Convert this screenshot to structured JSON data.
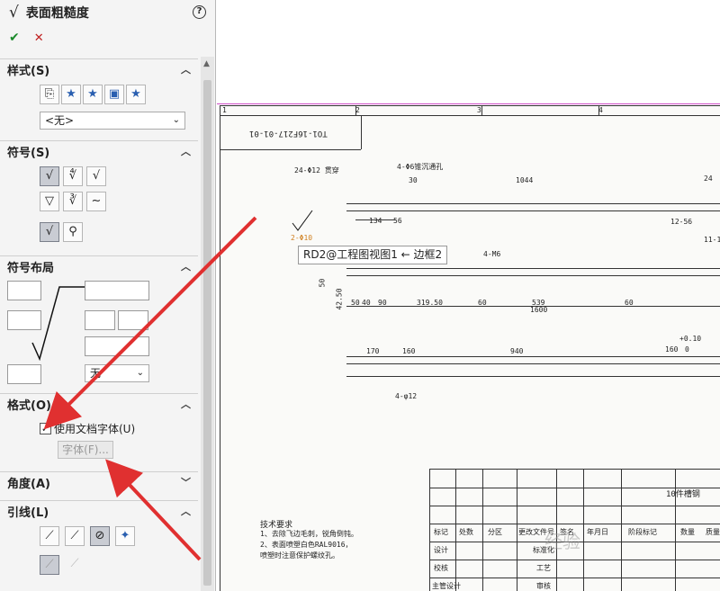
{
  "panel": {
    "title_symbol": "√",
    "title": "表面粗糙度",
    "help": "?",
    "ok": "✔",
    "cancel": "✕",
    "style_section": {
      "title": "样式(S)",
      "select_value": "<无>"
    },
    "symbol_section": {
      "title": "符号(S)"
    },
    "layout_section": {
      "title": "符号布局",
      "select_value": "无"
    },
    "format_section": {
      "title": "格式(O)",
      "checkbox_label": "使用文档字体(U)",
      "checked": true,
      "font_button": "字体(F)..."
    },
    "angle_section": {
      "title": "角度(A)"
    },
    "leader_section": {
      "title": "引线(L)"
    }
  },
  "drawing": {
    "tooltip": "RD2@工程图视图1 ← 边框2",
    "zone_numbers": [
      "1",
      "2",
      "3",
      "4"
    ],
    "part_number": "TO1-16F217-01-01",
    "callouts": [
      "24-Φ12 贯穿",
      "4-Φ6锥沉通孔",
      "4-M6",
      "4-φ12",
      "2-Φ10"
    ],
    "dimensions": [
      "30",
      "1044",
      "24",
      "134",
      "56",
      "12-56",
      "11-1",
      "50",
      "42.50",
      "50",
      "40",
      "90",
      "319.50",
      "60",
      "539",
      "60",
      "1600",
      "170",
      "160",
      "940",
      "160",
      "+0.10",
      "0"
    ],
    "tech_notes": {
      "heading": "技术要求",
      "lines": [
        "1、去除飞边毛刺，锐角倒钝。",
        "2、表面喷塑白色RAL9016，",
        "喷塑时注意保护螺纹孔。"
      ]
    },
    "title_block": {
      "name": "10件槽钢",
      "header_cells": [
        "标记",
        "处数",
        "分区",
        "更改文件号",
        "签名",
        "年月日"
      ],
      "rows": [
        "设计",
        "校核",
        "主管设计"
      ],
      "right_cells": [
        "标准化",
        "工艺",
        "审核"
      ],
      "stage_cells": [
        "阶段标记",
        "数量",
        "质量"
      ]
    },
    "watermark": "经验"
  },
  "colors": {
    "arrow": "#e03030",
    "ok": "#1a8a2a",
    "cancel": "#c02020",
    "sheet_border": "#d04cc8"
  }
}
